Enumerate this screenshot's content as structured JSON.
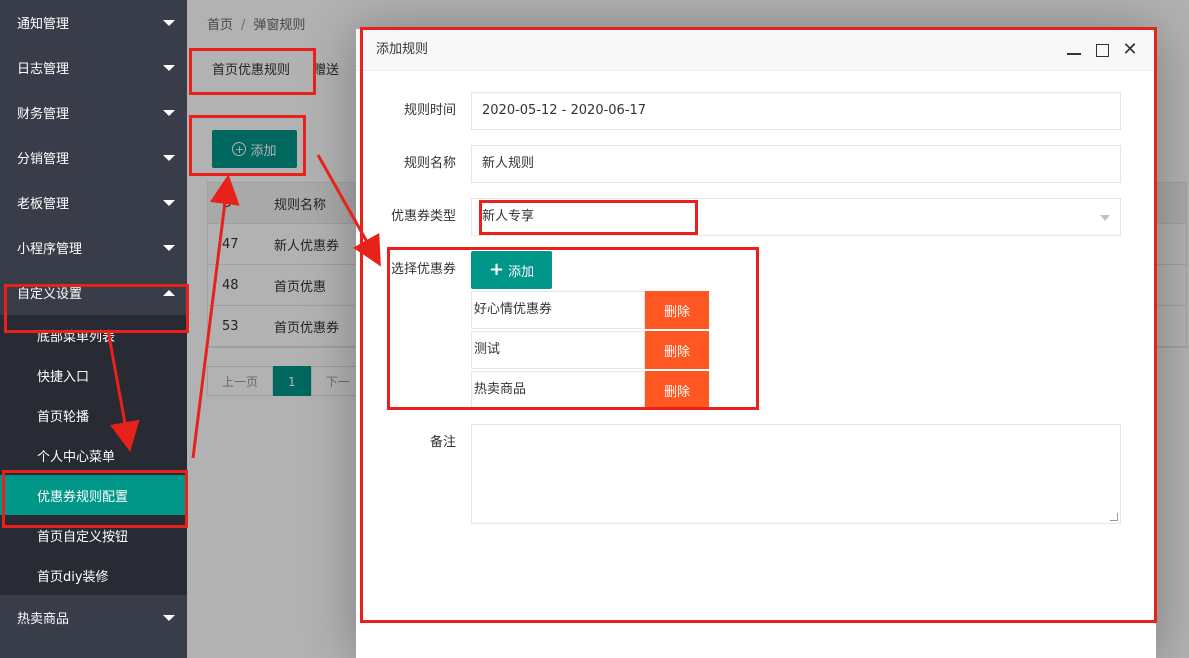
{
  "sidebar": {
    "items": [
      {
        "label": "通知管理"
      },
      {
        "label": "日志管理"
      },
      {
        "label": "财务管理"
      },
      {
        "label": "分销管理"
      },
      {
        "label": "老板管理"
      },
      {
        "label": "小程序管理"
      },
      {
        "label": "自定义设置"
      }
    ],
    "sub_items": [
      {
        "label": "底部菜单列表"
      },
      {
        "label": "快捷入口"
      },
      {
        "label": "首页轮播"
      },
      {
        "label": "个人中心菜单"
      },
      {
        "label": "优惠券规则配置"
      },
      {
        "label": "首页自定义按钮"
      },
      {
        "label": "首页diy装修"
      }
    ],
    "bottom_item": {
      "label": "热卖商品"
    }
  },
  "breadcrumb": {
    "home": "首页",
    "separator": "/",
    "current": "弹窗规则"
  },
  "tabs": [
    {
      "label": "首页优惠规则"
    },
    {
      "label": "赠送"
    }
  ],
  "toolbar": {
    "add_label": "添加"
  },
  "table": {
    "headers": [
      "D",
      "规则名称"
    ],
    "rows": [
      [
        "47",
        "新人优惠券"
      ],
      [
        "48",
        "首页优惠"
      ],
      [
        "53",
        "首页优惠券"
      ]
    ]
  },
  "pager": {
    "prev": "上一页",
    "current": "1",
    "next": "下一"
  },
  "dialog": {
    "title": "添加规则",
    "fields": {
      "time_label": "规则时间",
      "time_value": "2020-05-12 - 2020-06-17",
      "name_label": "规则名称",
      "name_value": "新人规则",
      "type_label": "优惠券类型",
      "type_value": "新人专享",
      "coupon_label": "选择优惠券",
      "coupon_add": "添加",
      "remark_label": "备注"
    },
    "coupons": [
      {
        "name": "好心情优惠券",
        "action": "删除"
      },
      {
        "name": "测试",
        "action": "删除"
      },
      {
        "name": "热卖商品",
        "action": "删除"
      }
    ]
  },
  "colors": {
    "accent": "#009688",
    "danger": "#ff5722",
    "sidebar": "#393d49",
    "highlight": "#e8211a"
  }
}
